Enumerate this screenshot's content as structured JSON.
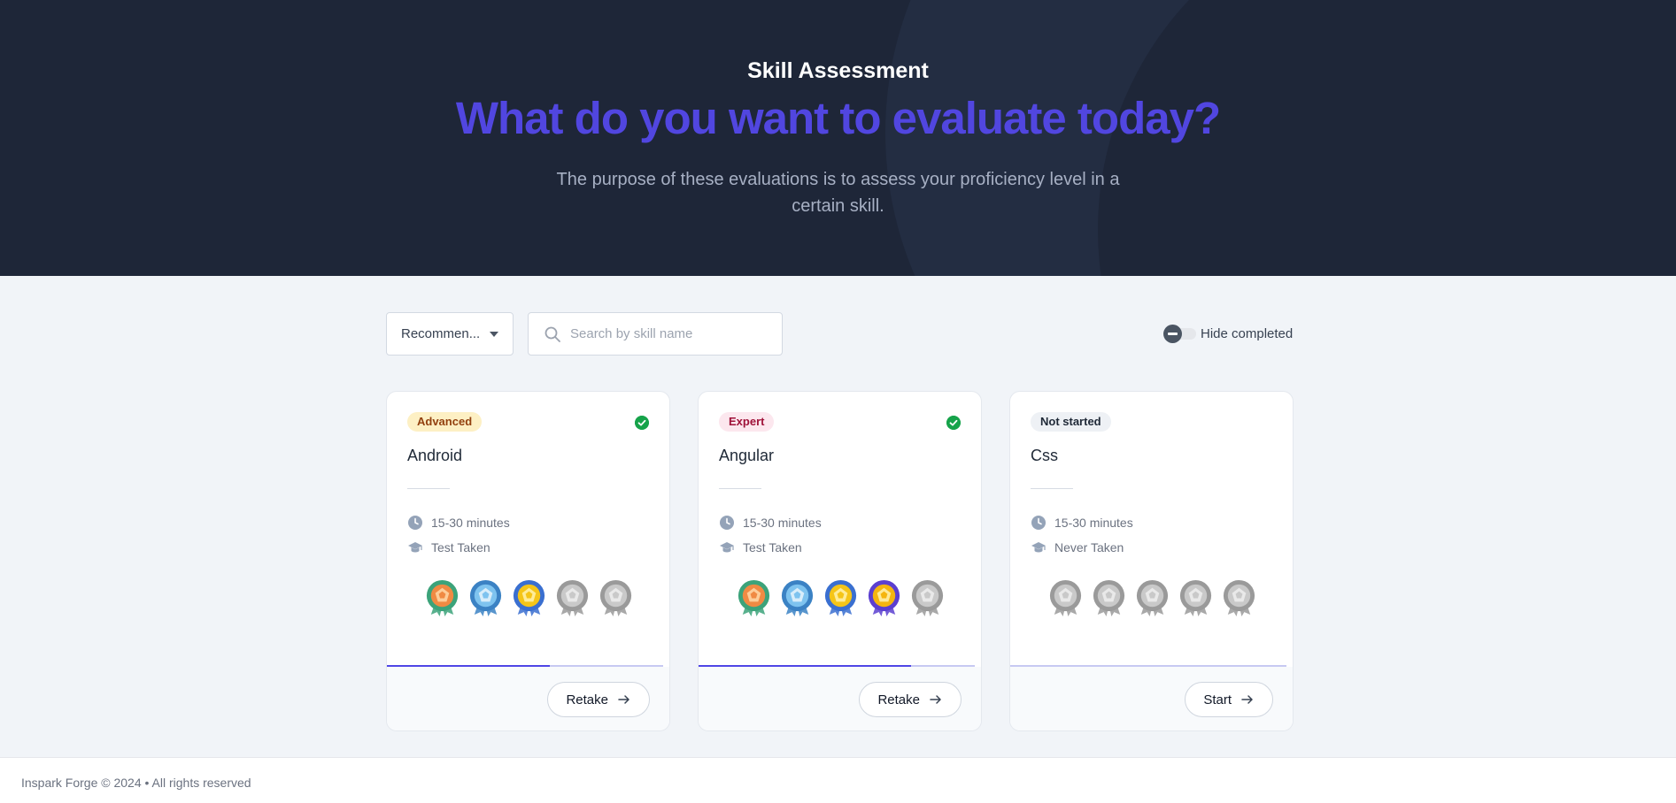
{
  "hero": {
    "kicker": "Skill Assessment",
    "title": "What do you want to evaluate today?",
    "description": "The purpose of these evaluations is to assess your proficiency level in a certain skill."
  },
  "toolbar": {
    "sort_value": "Recommen...",
    "search_placeholder": "Search by skill name",
    "search_value": "",
    "hide_completed_label": "Hide completed",
    "hide_completed_on": false
  },
  "cards": [
    {
      "badge": "Advanced",
      "badge_bg": "#fdf0c4",
      "badge_color": "#92400e",
      "completed": true,
      "title": "Android",
      "duration": "15-30 minutes",
      "status": "Test Taken",
      "medals": [
        "bronze",
        "silver",
        "gold",
        "locked",
        "locked"
      ],
      "progress": 0.59,
      "action": "Retake"
    },
    {
      "badge": "Expert",
      "badge_bg": "#fce7ee",
      "badge_color": "#9f1239",
      "completed": true,
      "title": "Angular",
      "duration": "15-30 minutes",
      "status": "Test Taken",
      "medals": [
        "bronze",
        "silver",
        "gold",
        "platinum",
        "locked"
      ],
      "progress": 0.77,
      "action": "Retake"
    },
    {
      "badge": "Not started",
      "badge_bg": "#eef1f5",
      "badge_color": "#1f2937",
      "completed": false,
      "title": "Css",
      "duration": "15-30 minutes",
      "status": "Never Taken",
      "medals": [
        "locked",
        "locked",
        "locked",
        "locked",
        "locked"
      ],
      "progress": 0,
      "action": "Start"
    }
  ],
  "footer": {
    "text": "Inspark Forge © 2024 • All rights reserved"
  },
  "colors": {
    "hero_bg": "#1e2638",
    "accent": "#5146e0",
    "success": "#16a34a"
  }
}
